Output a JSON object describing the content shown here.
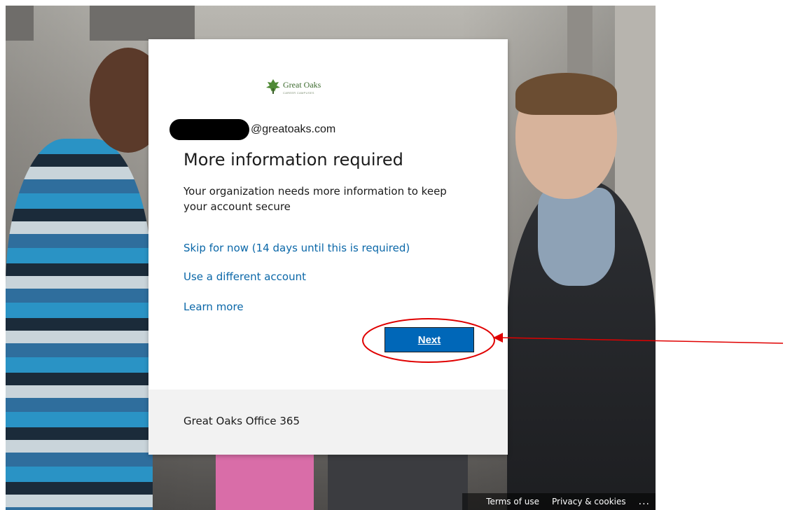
{
  "card": {
    "logo": {
      "name": "Great Oaks",
      "subtitle": "CAREER CAMPUSES"
    },
    "email_domain": "@greatoaks.com",
    "title": "More information required",
    "description": "Your organization needs more information to keep your account secure",
    "links": {
      "skip": "Skip for now (14 days until this is required)",
      "different_account": "Use a different account",
      "learn_more": "Learn more"
    },
    "next_button": "Next",
    "footer_org": "Great Oaks Office 365"
  },
  "page_footer": {
    "terms": "Terms of use",
    "privacy": "Privacy & cookies",
    "more": "..."
  },
  "colors": {
    "link": "#0a67a8",
    "primary_button": "#0067b8",
    "annotation": "#e00000",
    "footer_bg": "#f2f2f2"
  }
}
